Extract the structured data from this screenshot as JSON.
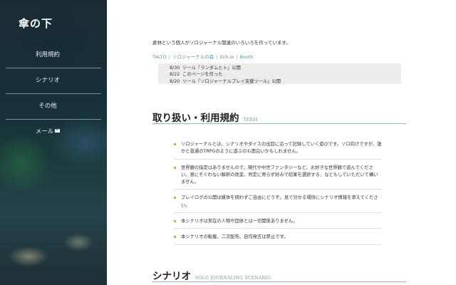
{
  "sidebar": {
    "title": "傘の下",
    "nav": [
      {
        "label": "利用規約"
      },
      {
        "label": "シナリオ"
      },
      {
        "label": "その他"
      },
      {
        "label": "メール"
      }
    ]
  },
  "intro": "倉林という個人がソロジャーナル関連のいろいろを作っています。",
  "links": [
    "TALTO",
    "ソロジャーナルの森",
    "itch.io",
    "Booth"
  ],
  "news": [
    {
      "date": "8/30",
      "text": "ツール『ランダムヒト』公開"
    },
    {
      "date": "8/22",
      "text": "このページを作った"
    },
    {
      "date": "8/20",
      "text": "ツール『ソロジャーナルプレイ支援ツール』公開"
    }
  ],
  "terms_section": {
    "title": "取り扱い・利用規約",
    "subtitle": "TERM",
    "items": [
      "ソロジャーナルとは、シナリオやダイスの出目に沿って記録していく遊びです。ソロ向けですが、誰かと普通のTRPGのように遊ぶのも面白いかもしれません。",
      "世界観の指定はありませんので、現代や中世ファンタジーなど、お好きな世界観で遊んでください。意にそぐわない解釈の改変、判定に寄らず好みで結果を選択する、などもしていただいて構いません。",
      "プレイログの公開は媒体を問わずご自由にどうぞ。見て分かる場所にシナリオ情報を添えてください。",
      "本シナリオは実在の人物や団体とは一切関係ありません。",
      "本シナリオの転載、二次配布、自作発言は禁止です。"
    ]
  },
  "scenario_section": {
    "title": "シナリオ",
    "subtitle": "SOLO JOURNALING SCENARIO"
  }
}
